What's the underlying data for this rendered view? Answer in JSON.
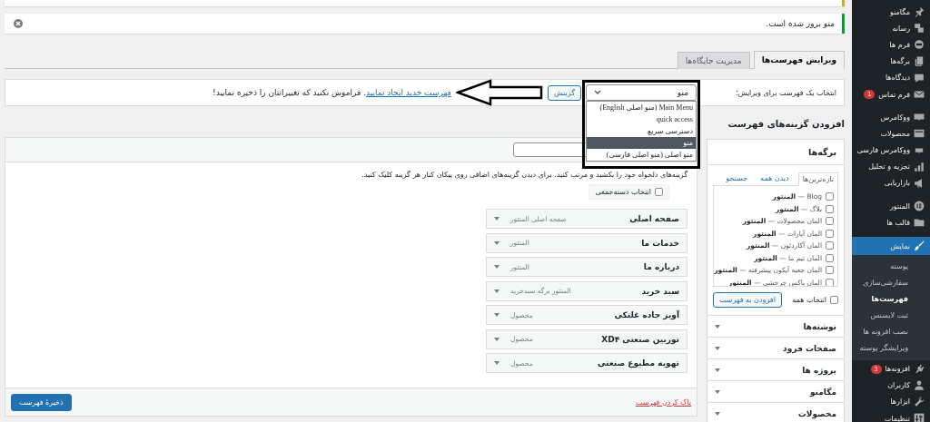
{
  "sidebar": {
    "groups": [
      {
        "items": [
          {
            "label": "مگامنو",
            "selected": false
          },
          {
            "label": "رسانه",
            "selected": false
          },
          {
            "label": "فرم ها",
            "selected": false
          },
          {
            "label": "برگه‌ها",
            "selected": false
          },
          {
            "label": "دیدگاه‌ها",
            "selected": false
          },
          {
            "label": "فرم تماس",
            "badge": "1",
            "selected": false
          }
        ]
      },
      {
        "items": [
          {
            "label": "ووکامرس",
            "selected": false
          },
          {
            "label": "محصولات",
            "selected": false
          },
          {
            "label": "ووکامرس فارسی",
            "selected": false
          },
          {
            "label": "تجزیه و تحلیل",
            "selected": false
          },
          {
            "label": "بازاریابی",
            "selected": false
          }
        ]
      },
      {
        "items": [
          {
            "label": "المنتور",
            "selected": false
          },
          {
            "label": "قالب ها",
            "selected": false
          }
        ]
      },
      {
        "items": [
          {
            "label": "نمایش",
            "selected": true,
            "children": [
              {
                "label": "پوسته",
                "selected": false
              },
              {
                "label": "سفارشی‌سازی",
                "selected": false
              },
              {
                "label": "فهرست‌ها",
                "selected": true
              },
              {
                "label": "ثبت لایسنس",
                "selected": false
              },
              {
                "label": "نصب افزونه ها",
                "selected": false
              },
              {
                "label": "ویرایشگر پوسته",
                "selected": false
              }
            ]
          },
          {
            "label": "افزونه‌ها",
            "badge": "3",
            "selected": false
          },
          {
            "label": "کاربران",
            "selected": false
          },
          {
            "label": "ابزارها",
            "selected": false
          },
          {
            "label": "تنظیمات",
            "selected": false
          }
        ]
      }
    ]
  },
  "notice": {
    "message": "منو بروز شده است."
  },
  "tabs": [
    {
      "label": "ویرایش فهرست‌ها",
      "selected": true
    },
    {
      "label": "مدیریت جایگاه‌ها",
      "selected": false
    }
  ],
  "menu_select": {
    "label": "انتخاب یک فهرست برای ویرایش:",
    "value": "منو",
    "options": [
      {
        "label": "Main Menu (منو اصلی English)",
        "selected": false
      },
      {
        "label": "quick access",
        "selected": false
      },
      {
        "label": "دسترسی سریع",
        "selected": false
      },
      {
        "label": "منو",
        "selected": true
      },
      {
        "label": "منو اصلی (منو اصلی فارسی)",
        "selected": false
      }
    ],
    "button": "گزینش",
    "create_link": "فهرست جدید ایجاد نمایید",
    "note": ". فراموش نکنید که تغییراتتان را ذخیره نمایید!"
  },
  "add_items": {
    "title": "افزودن گزینه‌های فهرست",
    "sections": [
      {
        "title": "برگه‌ها",
        "expanded": true,
        "tabs": [
          {
            "label": "تازه‌ترین‌ها",
            "selected": true
          },
          {
            "label": "دیدن همه",
            "selected": false
          },
          {
            "label": "جستجو",
            "selected": false
          }
        ],
        "pages": [
          {
            "label": "Blog — **المنتور**",
            "checked": false
          },
          {
            "label": "بلاگ — **المنتور**",
            "checked": false
          },
          {
            "label": "المان محصولات — **المنتور**",
            "checked": false
          },
          {
            "label": "المان آپارات — **المنتور**",
            "checked": false
          },
          {
            "label": "المان آکاردئون — **المنتور**",
            "checked": false
          },
          {
            "label": "المان تیم ما — **المنتور**",
            "checked": false
          },
          {
            "label": "المان جعبه آیکون پیشرفته — **المنتور**",
            "checked": false
          },
          {
            "label": "المان باکس چرخشی — **المنتور**",
            "checked": false
          }
        ],
        "select_all": {
          "label": "انتخاب همه",
          "checked": false
        },
        "add_button": "افزودن به فهرست"
      },
      {
        "title": "نوشته‌ها",
        "expanded": false
      },
      {
        "title": "صفحات فرود",
        "expanded": false
      },
      {
        "title": "پروژه ها",
        "expanded": false
      },
      {
        "title": "مگامنو",
        "expanded": false
      },
      {
        "title": "محصولات",
        "expanded": false
      }
    ]
  },
  "menu_structure": {
    "instructions": "گزینه‌های دلخواه خود را بکشید و مرتب کنید. برای دیدن گزینه‌های اضافی روی پیکان کنار هر گزینه کلیک کنید.",
    "bulk_select": {
      "label": "انتخاب دسته‌جمعی",
      "checked": false
    },
    "items": [
      {
        "title": "صفحه اصلی",
        "type": "صفحه اصلی المنتور"
      },
      {
        "title": "خدمات ما",
        "type": "المنتور"
      },
      {
        "title": "درباره ما",
        "type": "المنتور"
      },
      {
        "title": "سبد خرید",
        "type": "المنتور برگه سبدخرید"
      },
      {
        "title": "آویز جاده غلتکی",
        "type": "محصول"
      },
      {
        "title": "توربین صنعتی XD۴",
        "type": "محصول"
      },
      {
        "title": "تهویه مطبوع صنعتی",
        "type": "محصول"
      }
    ],
    "delete_link": "پاک کردن فهرست",
    "save_button": "ذخیرهٔ فهرست"
  }
}
